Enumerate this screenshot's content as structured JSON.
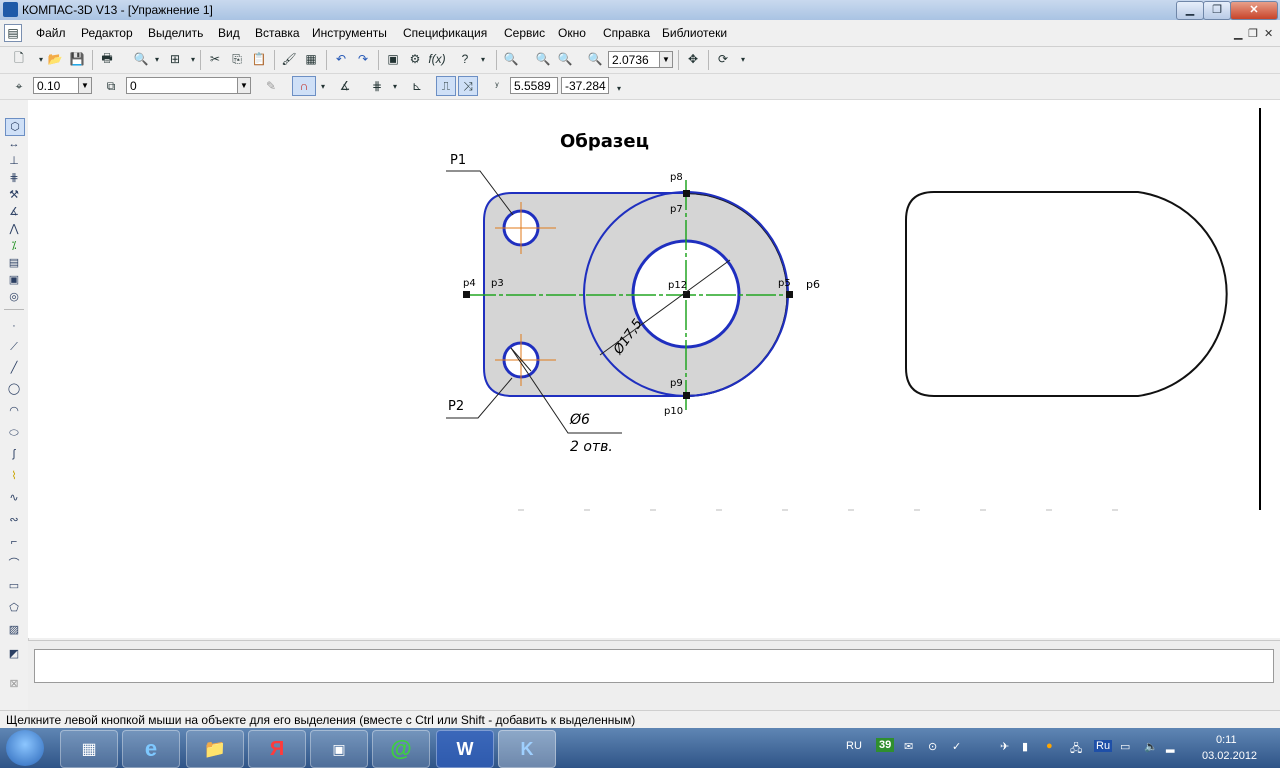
{
  "window": {
    "title": "КОМПАС-3D V13 - [Упражнение 1]"
  },
  "menu": [
    "Файл",
    "Редактор",
    "Выделить",
    "Вид",
    "Вставка",
    "Инструменты",
    "Спецификация",
    "Сервис",
    "Окно",
    "Справка",
    "Библиотеки"
  ],
  "toolbar1": {
    "zoom_value": "2.0736"
  },
  "toolbar2": {
    "step_value": "0.10",
    "layer_value": "0",
    "coord_x": "5.5589",
    "coord_y": "-37.284"
  },
  "drawing": {
    "title": "Образец",
    "labels": {
      "p1": "P1",
      "p2": "P2",
      "p3": "p3",
      "p4": "p4",
      "p5": "p5",
      "p6": "p6",
      "p7": "p7",
      "p8": "p8",
      "p9": "p9",
      "p10": "p10",
      "p12": "p12"
    },
    "dim_big": "Ø17,5",
    "dim_small": "Ø6",
    "dim_count": "2 отв."
  },
  "status": {
    "hint": "Щелкните левой кнопкой мыши на объекте для его выделения (вместе с Ctrl или Shift - добавить к выделенным)"
  },
  "taskbar": {
    "lang": "RU",
    "badge": "39",
    "tray_lang": "Ru",
    "time": "0:11",
    "date": "03.02.2012"
  },
  "colors": {
    "contour": "#1f2fbf",
    "axis": "#23a523",
    "center": "#e07a1a",
    "fill": "#d5d5d5",
    "title_grad_top": "#c9d9ee",
    "taskbar": "#3a628f"
  }
}
